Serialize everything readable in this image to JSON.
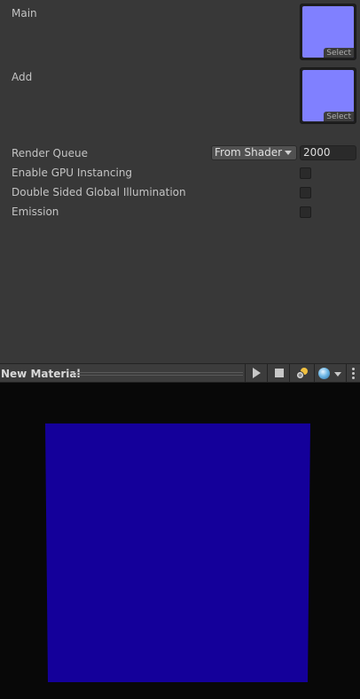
{
  "inspector": {
    "textures": [
      {
        "label": "Main",
        "select_label": "Select",
        "color": "#8080ff"
      },
      {
        "label": "Add",
        "select_label": "Select",
        "color": "#8080ff"
      }
    ],
    "render_queue": {
      "label": "Render Queue",
      "dropdown_value": "From Shader",
      "queue_value": "2000"
    },
    "toggles": [
      {
        "label": "Enable GPU Instancing",
        "checked": false
      },
      {
        "label": "Double Sided Global Illumination",
        "checked": false
      },
      {
        "label": "Emission",
        "checked": false
      }
    ]
  },
  "preview": {
    "title": "New Material",
    "quad_color": "#14009a",
    "background_color": "#080808",
    "icons": [
      "play-icon",
      "stop-icon",
      "light-icon",
      "sphere-icon",
      "more-icon"
    ]
  }
}
